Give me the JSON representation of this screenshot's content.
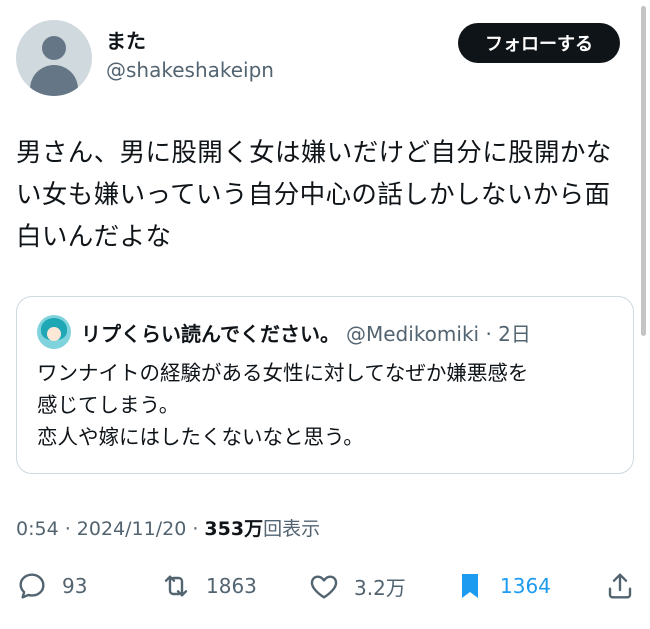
{
  "author": {
    "display_name": "また",
    "handle": "@shakeshakeipn",
    "avatar_icon": "default-avatar-icon"
  },
  "follow_button": {
    "label": "フォローする"
  },
  "tweet": {
    "lines": [
      "男さん、男に股開く女は嫌いだけど自分に股開かな",
      "い女も嫌いっていう自分中心の話しかしないから面",
      "白いんだよな"
    ]
  },
  "quote": {
    "display_name": "リプくらい読んでください。",
    "meta": "@Medikomiki · 2日",
    "lines": [
      "ワンナイトの経験がある女性に対してなぜか嫌悪感を",
      "感じてしまう。",
      "恋人や嫁にはしたくないなと思う。"
    ]
  },
  "meta": {
    "time_date": "0:54 · 2024/11/20 · ",
    "views_count": "353万",
    "views_label": "回表示"
  },
  "actions": {
    "reply": {
      "icon": "reply-icon",
      "count": "93"
    },
    "retweet": {
      "icon": "retweet-icon",
      "count": "1863"
    },
    "like": {
      "icon": "heart-icon",
      "count": "3.2万"
    },
    "bookmark": {
      "icon": "bookmark-icon",
      "count": "1364"
    },
    "share": {
      "icon": "share-icon"
    }
  },
  "colors": {
    "text_primary": "#0f1419",
    "text_secondary": "#536471",
    "accent_blue": "#1d9bf0",
    "border": "#cfd9de"
  }
}
